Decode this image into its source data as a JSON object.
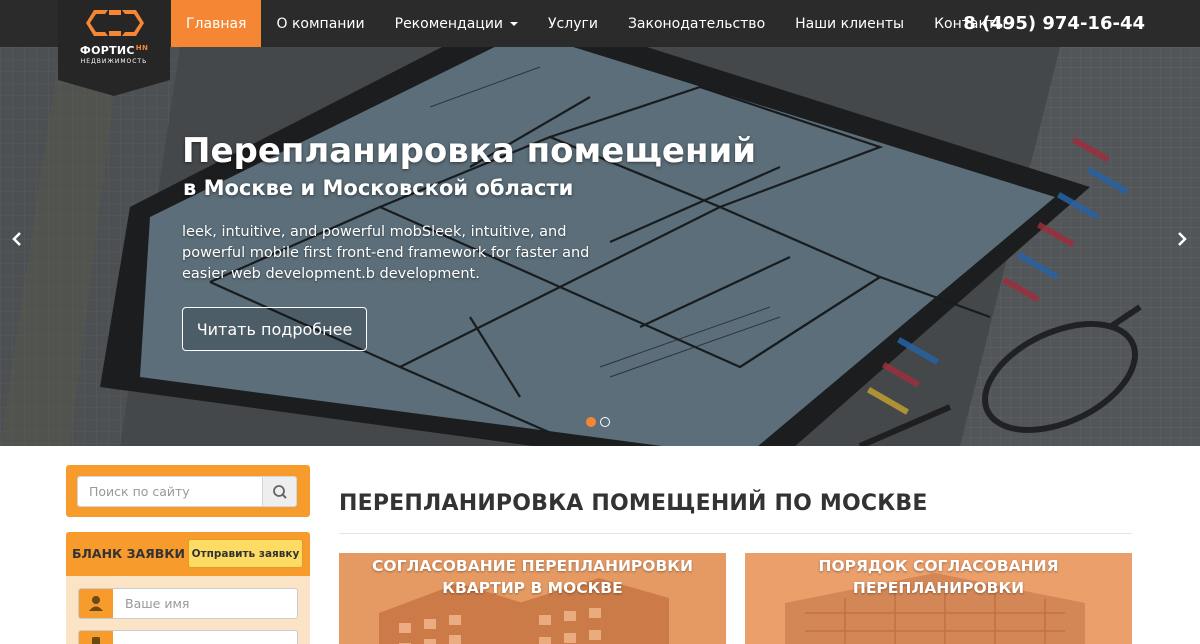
{
  "logo": {
    "name": "ФОРТИС",
    "name_accent": "HN",
    "subtitle": "НЕДВИЖИМОСТЬ"
  },
  "nav": {
    "items": [
      {
        "label": "Главная",
        "active": true
      },
      {
        "label": "О компании"
      },
      {
        "label": "Рекомендации",
        "has_dropdown": true
      },
      {
        "label": "Услуги"
      },
      {
        "label": "Законодательство"
      },
      {
        "label": "Наши клиенты"
      },
      {
        "label": "Контакты"
      }
    ],
    "phone": "8 (495) 974-16-44"
  },
  "hero": {
    "title": "Перепланировка помещений",
    "subtitle": "в Москве и Московской области",
    "text": "leek, intuitive, and powerful mobSleek, intuitive, and powerful mobile first front-end framework for faster and easier web development.b development.",
    "button_label": "Читать подробнее",
    "slides": 2,
    "active_slide": 1
  },
  "sidebar": {
    "search": {
      "placeholder": "Поиск по сайту"
    },
    "form": {
      "title": "БЛАНК ЗАЯВКИ",
      "send_label": "Отправить заявку",
      "name_placeholder": "Ваше имя"
    }
  },
  "main": {
    "heading": "ПЕРЕПЛАНИРОВКА ПОМЕЩЕНИЙ ПО МОСКВЕ",
    "cards": [
      {
        "title_line1": "СОГЛАСОВАНИЕ ПЕРЕПЛАНИРОВКИ",
        "title_line2": "КВАРТИР В МОСКВЕ"
      },
      {
        "title_line1": "ПОРЯДОК СОГЛАСОВАНИЯ",
        "title_line2": "ПЕРЕПЛАНИРОВКИ"
      }
    ]
  },
  "colors": {
    "accent": "#f58634",
    "navbar": "#2b2b2b",
    "sidebar_box": "#f79b2c",
    "send_button": "#fedb62"
  },
  "icons": {
    "search": "search-icon",
    "user": "user-icon",
    "phone": "phone-icon",
    "prev": "chevron-left-icon",
    "next": "chevron-right-icon"
  }
}
